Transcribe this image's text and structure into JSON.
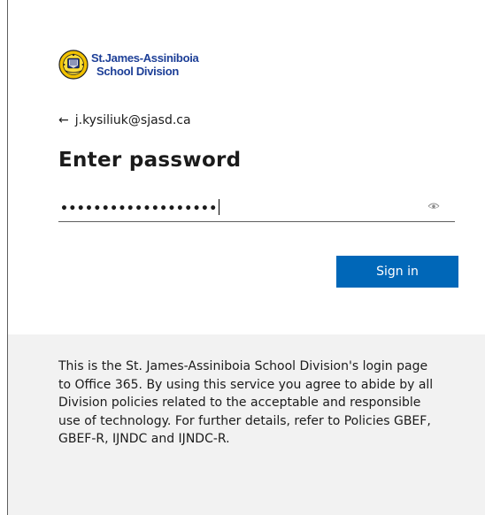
{
  "logo": {
    "line1": "St.James-Assiniboia",
    "line2": "School Division",
    "brand_color": "#1d3f97",
    "icon": "school-crest-icon"
  },
  "identity": {
    "back_icon": "back-arrow-icon",
    "email": "j.kysiliuk@sjasd.ca"
  },
  "title": "Enter password",
  "password": {
    "masked_value": "•••••••••••••••••••",
    "reveal_icon": "eye-icon"
  },
  "signin": {
    "label": "Sign in",
    "color": "#0067b8"
  },
  "footer": {
    "text": "This is the St. James-Assiniboia School Division's login page to Office 365. By using this service you agree to abide by all Division policies related to the acceptable and responsible use of technology. For further details, refer to Policies GBEF, GBEF-R, IJNDC and IJNDC-R.",
    "background": "#f2f2f2"
  }
}
